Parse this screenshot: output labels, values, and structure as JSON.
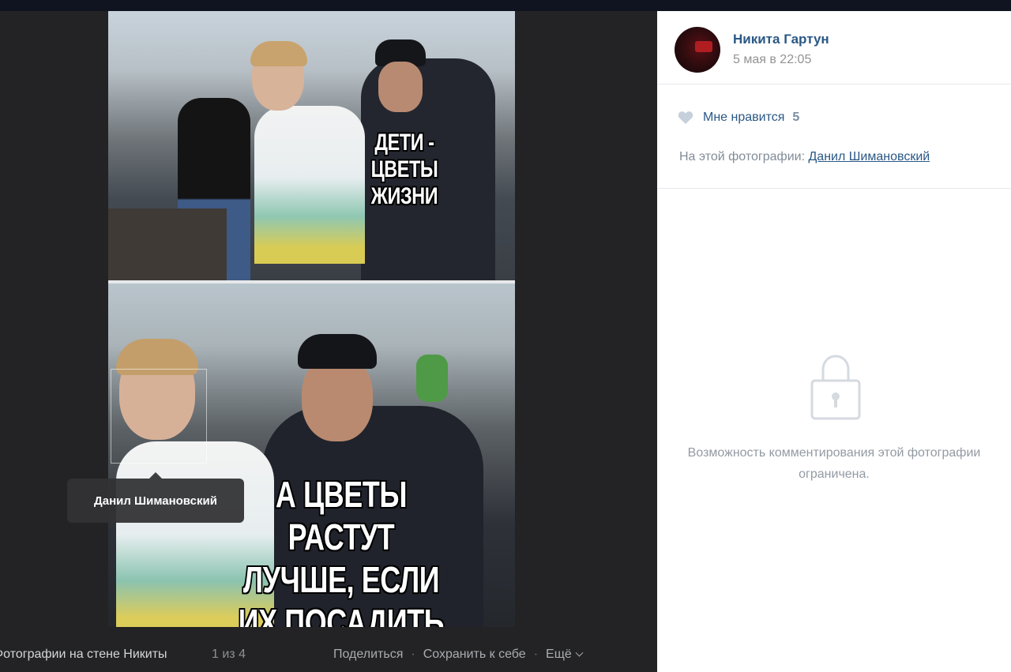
{
  "photo": {
    "top_caption": "ДЕТИ - ЦВЕТЫ\nЖИЗНИ",
    "bottom_caption": "А ЦВЕТЫ РАСТУТ\nЛУЧШЕ, ЕСЛИ\nИХ ПОСАДИТЬ",
    "tag_tooltip": "Данил Шимановский"
  },
  "bottom_bar": {
    "album": "Фотографии на стене Никиты",
    "counter": "1 из 4",
    "share": "Поделиться",
    "save": "Сохранить к себе",
    "more": "Ещё"
  },
  "sidebar": {
    "author": "Никита Гартун",
    "date": "5 мая в 22:05",
    "like_label": "Мне нравится",
    "like_count": "5",
    "on_photo_label": "На этой фотографии:",
    "on_photo_person": "Данил Шимановский",
    "restricted_text": "Возможность комментирования этой фотографии ограничена."
  },
  "icons": {
    "like": "heart-icon",
    "lock": "lock-icon",
    "more": "chevron-down-icon"
  },
  "colors": {
    "link": "#2a5885",
    "viewer_bg": "#232325"
  }
}
